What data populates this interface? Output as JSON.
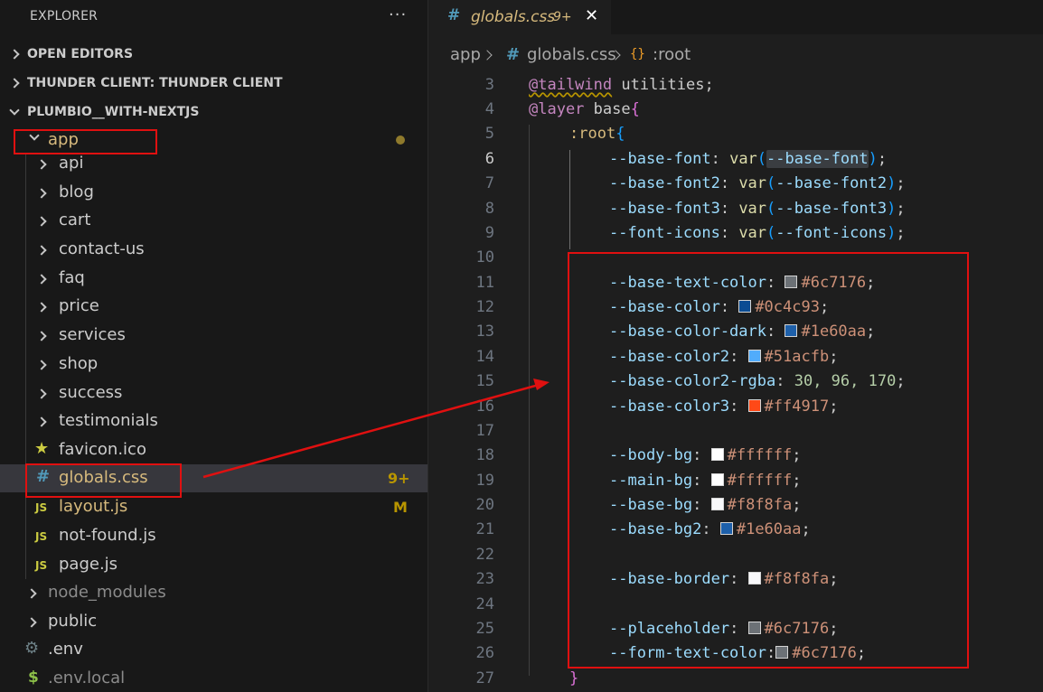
{
  "sidebar": {
    "title": "EXPLORER",
    "more_label": "···",
    "sections": [
      {
        "label": "OPEN EDITORS"
      },
      {
        "label": "THUNDER CLIENT: THUNDER CLIENT"
      },
      {
        "label": "PLUMBIO__WITH-NEXTJS"
      }
    ],
    "app_folder": "app",
    "folders": [
      "api",
      "blog",
      "cart",
      "contact-us",
      "faq",
      "price",
      "services",
      "shop",
      "success",
      "testimonials"
    ],
    "files": [
      {
        "name": "favicon.ico",
        "icon": "star-icon",
        "badge": ""
      },
      {
        "name": "globals.css",
        "icon": "hash-icon",
        "badge": "9+"
      },
      {
        "name": "layout.js",
        "icon": "js-icon",
        "badge": "M"
      },
      {
        "name": "not-found.js",
        "icon": "js-icon",
        "badge": ""
      },
      {
        "name": "page.js",
        "icon": "js-icon",
        "badge": ""
      }
    ],
    "js_icon_text": "JS",
    "hash_icon_text": "#",
    "root_items": [
      {
        "name": "node_modules"
      },
      {
        "name": "public"
      }
    ],
    "root_files": [
      {
        "name": ".env",
        "icon": "gear-icon"
      },
      {
        "name": ".env.local",
        "icon": "dollar-icon"
      }
    ]
  },
  "tab": {
    "hash": "#",
    "name": "globals.css",
    "badge": "9+",
    "close": "✕"
  },
  "breadcrumb": {
    "folder": "app",
    "hash": "#",
    "file": "globals.css",
    "symbol_icon": "{}",
    "symbol": ":root"
  },
  "editor": {
    "line_numbers": [
      "3",
      "4",
      "5",
      "6",
      "7",
      "8",
      "9",
      "10",
      "11",
      "12",
      "13",
      "14",
      "15",
      "16",
      "17",
      "18",
      "19",
      "20",
      "21",
      "22",
      "23",
      "24",
      "25",
      "26",
      "27"
    ],
    "active_line": "6",
    "text": {
      "tailwind_at": "@tailwind",
      "utilities": " utilities;",
      "layer_at": "@layer",
      "base": " base",
      "open_brace": "{",
      "root": ":root",
      "close_brace": "}",
      "var_fn": "var",
      "colon": ": ",
      "semi": ";"
    },
    "var_lines": [
      {
        "prop": "--base-font",
        "arg": "--base-font"
      },
      {
        "prop": "--base-font2",
        "arg": "--base-font2"
      },
      {
        "prop": "--base-font3",
        "arg": "--base-font3"
      },
      {
        "prop": "--font-icons",
        "arg": "--font-icons"
      }
    ],
    "color_lines": [
      {
        "prop": "--base-text-color",
        "value": "#6c7176",
        "swatch": "#6c7176"
      },
      {
        "prop": "--base-color",
        "value": "#0c4c93",
        "swatch": "#0c4c93"
      },
      {
        "prop": "--base-color-dark",
        "value": "#1e60aa",
        "swatch": "#1e60aa"
      },
      {
        "prop": "--base-color2",
        "value": "#51acfb",
        "swatch": "#51acfb"
      },
      {
        "prop": "--base-color2-rgba",
        "value": "30, 96, 170",
        "swatch": ""
      },
      {
        "prop": "--base-color3",
        "value": "#ff4917",
        "swatch": "#ff4917"
      },
      {
        "prop": "--body-bg",
        "value": "#ffffff",
        "swatch": "#ffffff"
      },
      {
        "prop": "--main-bg",
        "value": "#ffffff",
        "swatch": "#ffffff"
      },
      {
        "prop": "--base-bg",
        "value": "#f8f8fa",
        "swatch": "#f8f8fa"
      },
      {
        "prop": "--base-bg2",
        "value": "#1e60aa",
        "swatch": "#1e60aa"
      },
      {
        "prop": "--base-border",
        "value": "#f8f8fa",
        "swatch": "#f8f8fa"
      },
      {
        "prop": "--placeholder",
        "value": "#6c7176",
        "swatch": "#6c7176"
      },
      {
        "prop": "--form-text-color",
        "value": "#6c7176",
        "swatch": "#6c7176"
      }
    ]
  },
  "colors": {
    "accent_folder": "#d7ba7d",
    "annotation_red": "#e01010"
  }
}
